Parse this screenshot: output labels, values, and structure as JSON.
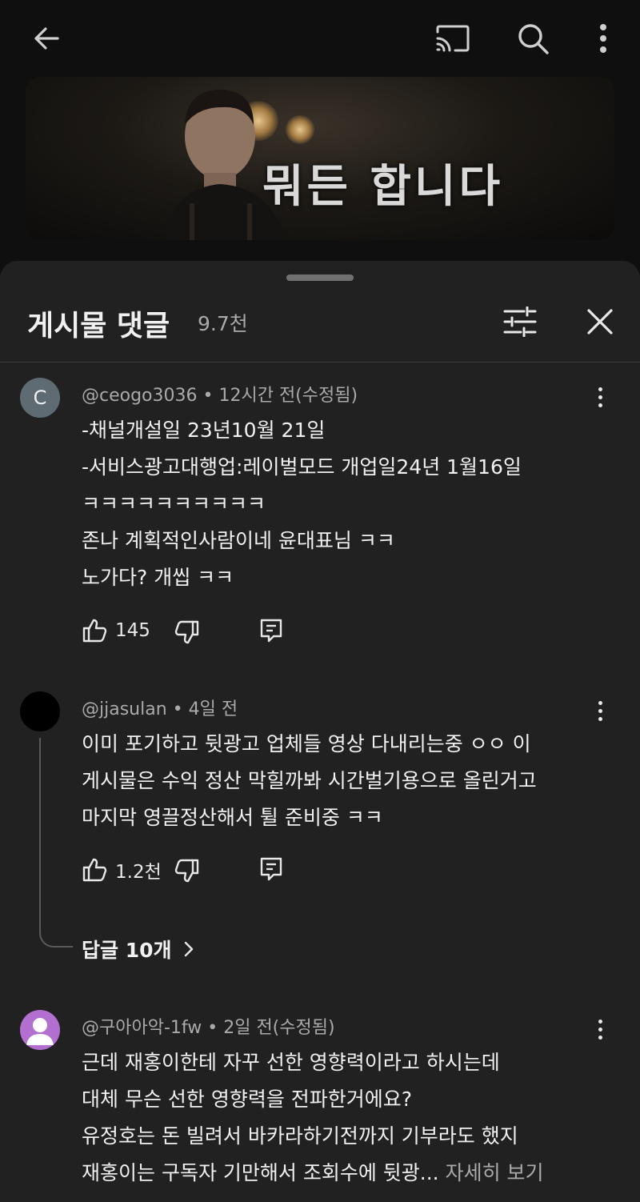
{
  "topbar": {
    "back_icon": "arrow-left-icon",
    "cast_icon": "cast-icon",
    "search_icon": "search-icon",
    "menu_icon": "more-vert-icon"
  },
  "post": {
    "thumbnail_text": "뭐든 합니다"
  },
  "sheet": {
    "title": "게시물 댓글",
    "count": "9.7천",
    "filter_icon": "sliders-icon",
    "close_icon": "close-icon"
  },
  "comments": [
    {
      "avatar_letter": "C",
      "avatar_color": "#5f6b73",
      "author": "@ceogo3036",
      "meta": " • 12시간 전(수정됨)",
      "lines": [
        "-채널개설일 23년10월  21일",
        "-서비스광고대행업:레이벌모드 개업일24년 1월16일",
        "ㅋㅋㅋㅋㅋㅋㅋㅋㅋㅋ",
        "존나 계획적인사람이네 윤대표님 ㅋㅋ",
        "노가다? 개씹 ㅋㅋ"
      ],
      "likes": "145"
    },
    {
      "avatar_color": "#000000",
      "author": "@jjasulan",
      "meta": " • 4일 전",
      "lines": [
        "이미 포기하고 뒷광고 업체들 영상 다내리는중 ㅇㅇ  이",
        "게시물은 수익 정산 막힐까봐 시간벌기용으로 올린거고",
        "마지막 영끌정산해서 튈 준비중 ㅋㅋ"
      ],
      "likes": "1.2천",
      "replies": "답글 10개"
    },
    {
      "avatar_color": "#b36fcf",
      "author": "@구아아악-1fw",
      "meta": " • 2일 전(수정됨)",
      "lines": [
        "근데 재홍이한테 자꾸 선한 영향력이라고 하시는데",
        "대체 무슨 선한 영향력을 전파한거에요?",
        "유정호는 돈 빌려서 바카라하기전까지 기부라도 했지",
        "재홍이는 구독자 기만해서 조회수에 뒷광..."
      ],
      "read_more": " 자세히 보기"
    }
  ]
}
